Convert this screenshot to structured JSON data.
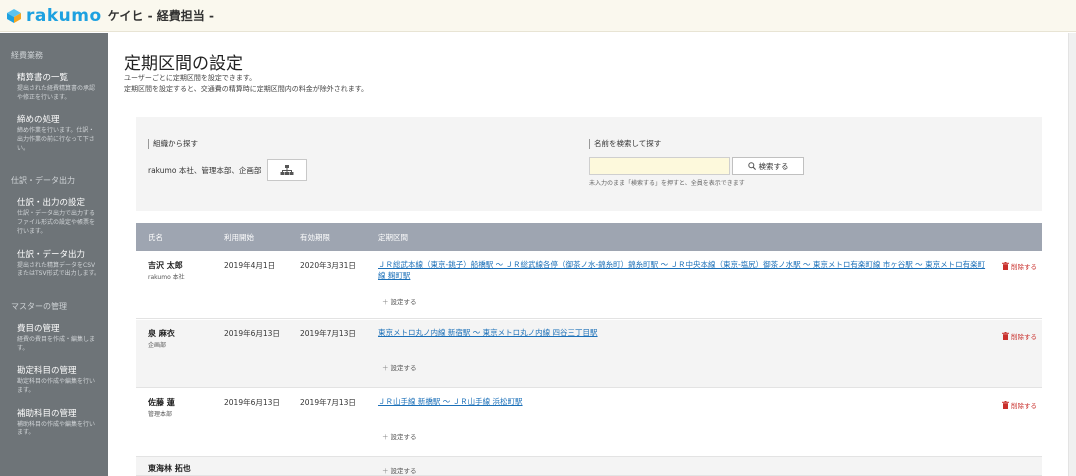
{
  "header": {
    "logo_text": "rakumo",
    "company": "ケイヒ - 経費担当 -"
  },
  "sidebar": {
    "sections": [
      {
        "title": "経費業務",
        "items": [
          {
            "title": "精算書の一覧",
            "desc": "提出された経費精算書の承認や修正を行います。"
          },
          {
            "title": "締めの処理",
            "desc": "締め作業を行います。仕訳・出力作業の前に行なって下さい。"
          }
        ]
      },
      {
        "title": "仕訳・データ出力",
        "items": [
          {
            "title": "仕訳・出力の設定",
            "desc": "仕訳・データ出力で出力するファイル形式の設定や帳票を行います。"
          },
          {
            "title": "仕訳・データ出力",
            "desc": "提出された精算データをCSVまたはTSV形式で出力します。"
          }
        ]
      },
      {
        "title": "マスターの管理",
        "items": [
          {
            "title": "費目の管理",
            "desc": "経費の費目を作成・編集します。"
          },
          {
            "title": "勘定科目の管理",
            "desc": "勘定科目の作成や編集を行います。"
          },
          {
            "title": "補助科目の管理",
            "desc": "補助科目の作成や編集を行います。"
          }
        ]
      }
    ]
  },
  "page": {
    "title": "定期区間の設定",
    "description_1": "ユーザーごとに定期区間を設定できます。",
    "description_2": "定期区間を設定すると、交通費の精算時に定期区間内の料金が除外されます。"
  },
  "org_search": {
    "label": "組織から探す",
    "value": "rakumo 本社、管理本部、企画部"
  },
  "name_search": {
    "label": "名前を検索して探す",
    "input_value": "",
    "button_label": "検索する",
    "hint": "未入力のまま「検索する」を押すと、全員を表示できます"
  },
  "table": {
    "headers": {
      "name": "氏名",
      "start": "利用開始",
      "end": "有効期限",
      "route": "定期区間"
    },
    "add_label": "設定する",
    "delete_label": "削除する",
    "rows": [
      {
        "name": "吉沢 太郎",
        "dept": "rakumo 本社",
        "start": "2019年4月1日",
        "end": "2020年3月31日",
        "route": "ＪＲ総武本線（東京-銚子）船橋駅 〜 ＪＲ総武線各停（御茶ノ水-錦糸町）錦糸町駅 〜 ＪＲ中央本線（東京-塩尻）御茶ノ水駅 〜 東京メトロ有楽町線 市ヶ谷駅 〜 東京メトロ有楽町線 麹町駅"
      },
      {
        "name": "泉 麻衣",
        "dept": "企画部",
        "start": "2019年6月13日",
        "end": "2019年7月13日",
        "route": "東京メトロ丸ノ内線 新宿駅 〜 東京メトロ丸ノ内線 四谷三丁目駅"
      },
      {
        "name": "佐藤 蓮",
        "dept": "管理本部",
        "start": "2019年6月13日",
        "end": "2019年7月13日",
        "route": "ＪＲ山手線 新橋駅 〜 ＪＲ山手線 浜松町駅"
      },
      {
        "name": "東海林 拓也",
        "dept": "",
        "start": "",
        "end": "",
        "route": ""
      }
    ]
  },
  "colors": {
    "brand": "#1da1e0",
    "sidebar_bg": "#6e7478",
    "table_header_bg": "#9ea5b1",
    "link": "#1a6fb8",
    "delete": "#c9302c",
    "input_bg": "#fdf9dc"
  }
}
